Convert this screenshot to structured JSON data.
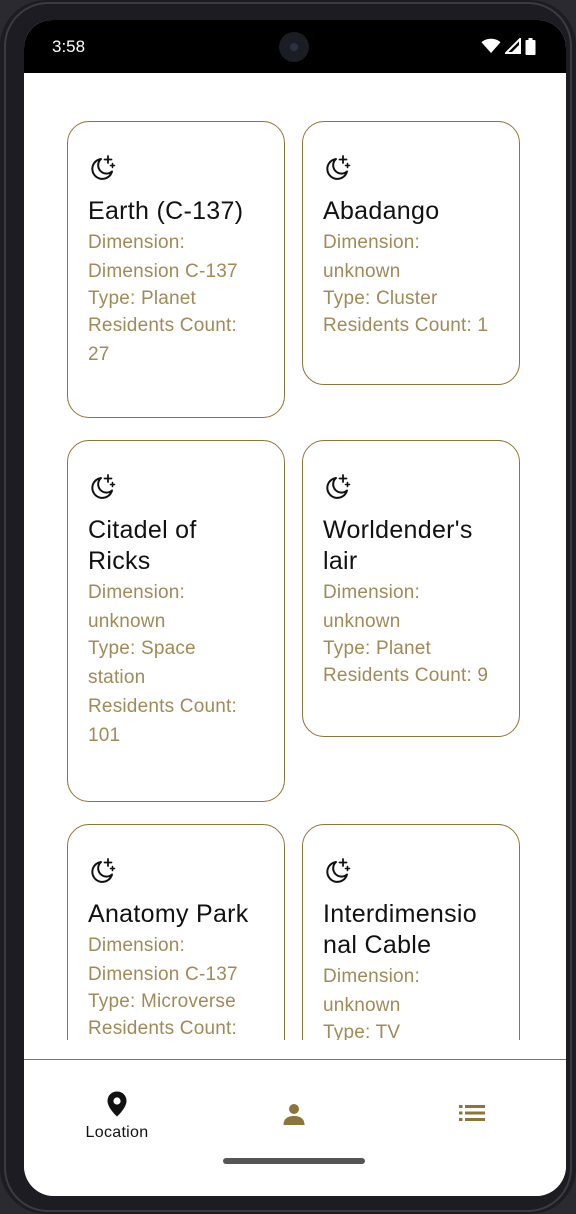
{
  "status_bar": {
    "time": "3:58"
  },
  "locations": [
    {
      "name": "Earth (C-137)",
      "dimension_label": "Dimension:",
      "dimension_value": "Dimension C-137",
      "type": "Type: Planet",
      "residents_label": "Residents Count:",
      "residents_value": "27"
    },
    {
      "name": "Abadango",
      "dimension_label": "Dimension:",
      "dimension_value": "unknown",
      "type": "Type: Cluster",
      "residents": "Residents Count: 1"
    },
    {
      "name_line1": "Citadel of",
      "name_line2": "Ricks",
      "dimension_label": "Dimension:",
      "dimension_value": "unknown",
      "type_line1": "Type: Space",
      "type_line2": "station",
      "residents_label": "Residents Count:",
      "residents_value": "101"
    },
    {
      "name_line1": "Worldender's",
      "name_line2": "lair",
      "dimension_label": "Dimension:",
      "dimension_value": "unknown",
      "type": "Type: Planet",
      "residents": "Residents Count: 9"
    },
    {
      "name": "Anatomy Park",
      "dimension_label": "Dimension:",
      "dimension_value": "Dimension C-137",
      "type": "Type: Microverse",
      "residents_label": "Residents Count:"
    },
    {
      "name_line1": "Interdimensio",
      "name_line2": "nal Cable",
      "dimension_label": "Dimension:",
      "dimension_value": "unknown",
      "type": "Type: TV"
    }
  ],
  "bottom_nav": {
    "items": [
      {
        "label": "Location",
        "icon": "location-pin-icon",
        "active": true
      },
      {
        "label": "",
        "icon": "person-icon",
        "active": false
      },
      {
        "label": "",
        "icon": "list-icon",
        "active": false
      }
    ]
  },
  "colors": {
    "accent": "#8d7438",
    "secondary_text": "#a08a57",
    "primary_text": "#111111"
  }
}
